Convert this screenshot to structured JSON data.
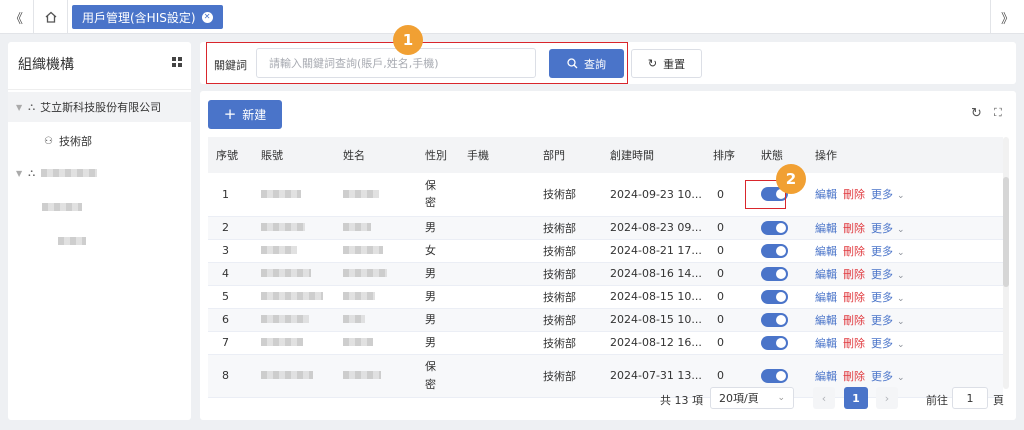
{
  "tabs": {
    "active_label": "用戶管理(含HIS設定)"
  },
  "left_panel": {
    "title": "組織機構",
    "tree": {
      "company": "艾立斯科技股份有限公司",
      "dept": "技術部"
    }
  },
  "search": {
    "keyword_label": "關鍵詞",
    "placeholder": "請輸入關鍵詞查詢(賬戶,姓名,手機)",
    "query_button": "查詢",
    "reset_button": "重置"
  },
  "toolbar": {
    "new_button": "新建"
  },
  "badges": {
    "one": "1",
    "two": "2"
  },
  "table": {
    "headers": {
      "index": "序號",
      "account": "賬號",
      "name": "姓名",
      "gender": "性別",
      "phone": "手機",
      "dept": "部門",
      "created": "創建時間",
      "order": "排序",
      "status": "狀態",
      "ops": "操作"
    },
    "rows": [
      {
        "index": "1",
        "gender": "保密",
        "dept": "技術部",
        "created": "2024-09-23 10...",
        "order": "0"
      },
      {
        "index": "2",
        "gender": "男",
        "dept": "技術部",
        "created": "2024-08-23 09...",
        "order": "0"
      },
      {
        "index": "3",
        "gender": "女",
        "dept": "技術部",
        "created": "2024-08-21 17...",
        "order": "0"
      },
      {
        "index": "4",
        "gender": "男",
        "dept": "技術部",
        "created": "2024-08-16 14...",
        "order": "0"
      },
      {
        "index": "5",
        "gender": "男",
        "dept": "技術部",
        "created": "2024-08-15 10...",
        "order": "0"
      },
      {
        "index": "6",
        "gender": "男",
        "dept": "技術部",
        "created": "2024-08-15 10...",
        "order": "0"
      },
      {
        "index": "7",
        "gender": "男",
        "dept": "技術部",
        "created": "2024-08-12 16...",
        "order": "0"
      },
      {
        "index": "8",
        "gender": "保密",
        "dept": "技術部",
        "created": "2024-07-31 13...",
        "order": "0"
      }
    ],
    "ops": {
      "edit": "編輯",
      "delete": "刪除",
      "more": "更多"
    }
  },
  "pagination": {
    "total": "共 13 項",
    "page_size": "20項/頁",
    "current": "1",
    "goto_prefix": "前往",
    "goto_value": "1",
    "goto_suffix": "頁"
  },
  "colors": {
    "primary": "#4a74c9",
    "danger": "#e0393e",
    "badge": "#f1a033",
    "highlight_border": "#d9262c"
  }
}
